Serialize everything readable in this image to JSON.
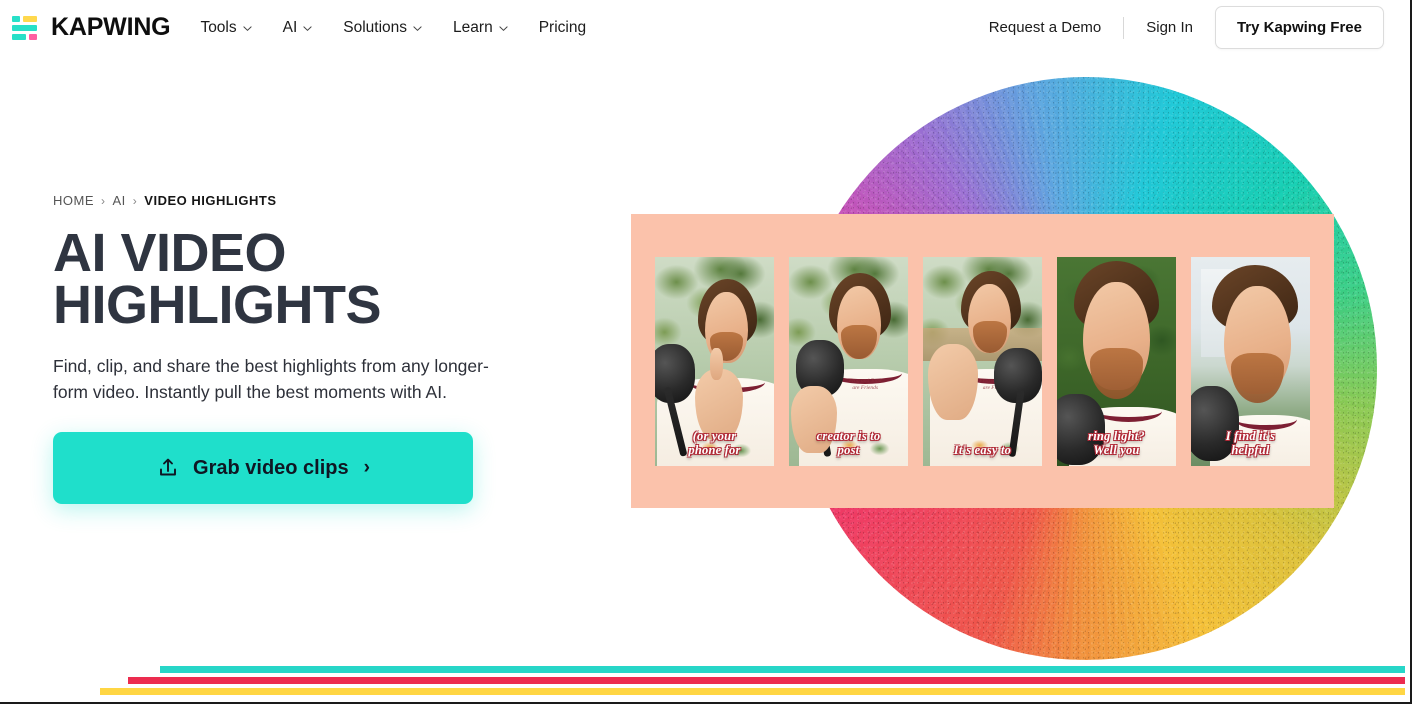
{
  "nav": {
    "brand": "KAPWING",
    "logo_colors": {
      "teal": "#27e0c8",
      "yellow": "#ffd84d",
      "pink": "#ff5fa2"
    },
    "links": [
      {
        "label": "Tools",
        "has_dropdown": true
      },
      {
        "label": "AI",
        "has_dropdown": true
      },
      {
        "label": "Solutions",
        "has_dropdown": true
      },
      {
        "label": "Learn",
        "has_dropdown": true
      },
      {
        "label": "Pricing",
        "has_dropdown": false
      }
    ],
    "request_demo": "Request a Demo",
    "sign_in": "Sign In",
    "cta": "Try Kapwing Free"
  },
  "breadcrumb": {
    "items": [
      {
        "label": "HOME",
        "current": false
      },
      {
        "label": "AI",
        "current": false
      },
      {
        "label": "VIDEO HIGHLIGHTS",
        "current": true
      }
    ],
    "separator": "›"
  },
  "hero": {
    "title": "AI VIDEO HIGHLIGHTS",
    "title_line1": "AI VIDEO",
    "title_line2": "HIGHLIGHTS",
    "subtitle": "Find, clip, and share the best highlights from any longer-form video. Instantly pull the best moments with AI.",
    "cta_label": "Grab video clips",
    "cta_arrow": "›",
    "cta_icon": "upload-icon",
    "cta_color": "#1fdfcb"
  },
  "visual": {
    "panel_color": "#fbc2ab",
    "gradient_circle": {
      "description": "noisy conic rainbow circle",
      "colors": [
        "#f0594c",
        "#ee2a78",
        "#9f6fd3",
        "#21c9d8",
        "#3ecf86",
        "#ddc23c",
        "#f5c13a"
      ]
    },
    "thumbnails": [
      {
        "caption": "(or your\nphone for",
        "caption_line1": "(or your",
        "caption_line2": "phone for",
        "scene": "outdoor-trees-pointing"
      },
      {
        "caption": "creator is to\npost",
        "caption_line1": "creator is to",
        "caption_line2": "post",
        "scene": "outdoor-trees-mic"
      },
      {
        "caption": "It's easy to",
        "caption_line1": "It's easy to",
        "caption_line2": "",
        "scene": "outdoor-deck-gesture"
      },
      {
        "caption": "ring light?\nWell you",
        "caption_line1": "ring light?",
        "caption_line2": "Well you",
        "scene": "green-hedge-closeup"
      },
      {
        "caption": "I find it's\nhelpful",
        "caption_line1": "I find it's",
        "caption_line2": "helpful",
        "scene": "city-background-closeup"
      }
    ]
  },
  "stripes": {
    "teal": "#27d6c8",
    "red": "#ec2c4f",
    "yellow": "#ffd644"
  }
}
